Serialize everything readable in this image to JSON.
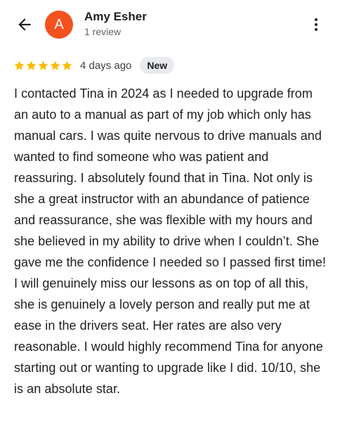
{
  "header": {
    "back_icon": "arrow-left-icon",
    "avatar_letter": "A",
    "avatar_color": "#f4511e",
    "user_name": "Amy Esher",
    "user_meta": "1 review",
    "more_icon": "more-vertical-icon"
  },
  "review": {
    "rating": 5,
    "max_rating": 5,
    "star_color": "#fbbc04",
    "date": "4 days ago",
    "badge": "New",
    "text": "I contacted Tina in 2024 as I needed to upgrade from an auto to a manual as part of my job which only has manual cars. I was quite nervous to drive manuals and wanted to find someone who was patient and reassuring. I absolutely found that in Tina. Not only is she a great instructor with an abundance of patience and reassurance, she was flexible with my hours and she believed in my ability to drive when I couldn’t. She gave me the confidence I needed so I passed first time! I will genuinely miss our lessons as on top of all this, she is genuinely a lovely person and really put me at ease in the drivers seat. Her rates are also very reasonable. I would highly recommend Tina for anyone starting out or wanting to upgrade like I did. 10/10, she is an absolute star."
  }
}
